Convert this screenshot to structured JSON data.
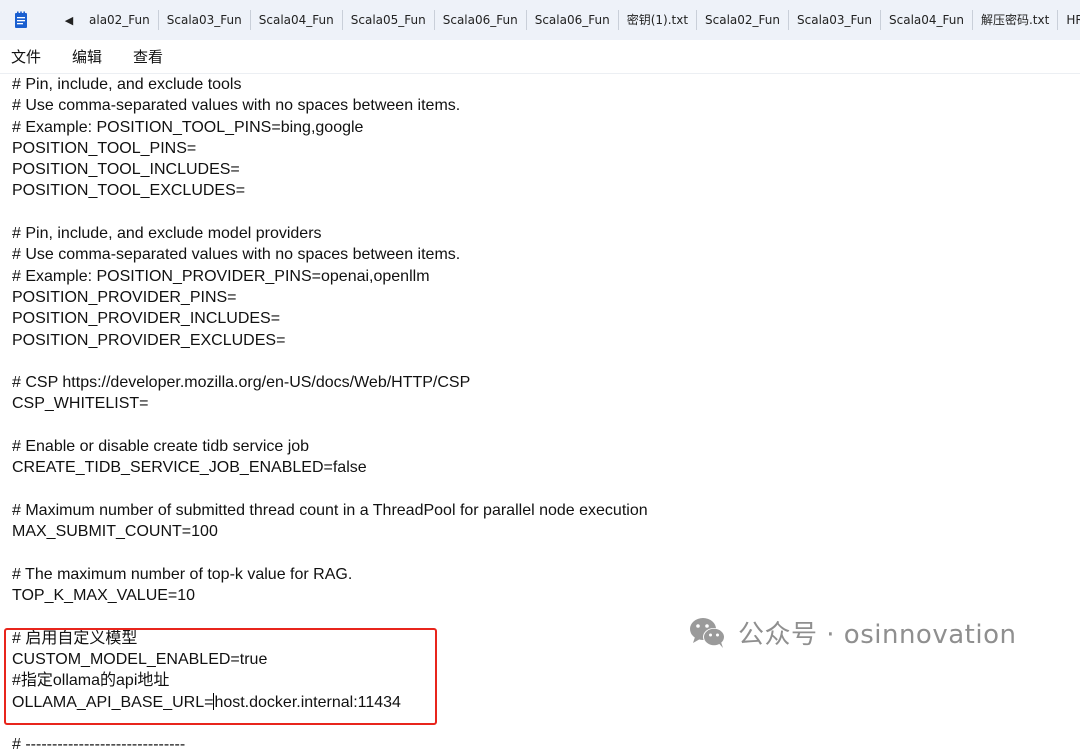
{
  "tabbar": {
    "scroll_left_icon": "◀",
    "tabs": [
      "ala02_Fun",
      "Scala03_Fun",
      "Scala04_Fun",
      "Scala05_Fun",
      "Scala06_Fun",
      "Scala06_Fun",
      "密钥(1).txt",
      "Scala02_Fun",
      "Scala03_Fun",
      "Scala04_Fun",
      "解压密码.txt",
      "HR-人"
    ]
  },
  "menubar": {
    "file": "文件",
    "edit": "编辑",
    "view": "查看"
  },
  "editor": {
    "lines": [
      "# Pin, include, and exclude tools",
      "# Use comma-separated values with no spaces between items.",
      "# Example: POSITION_TOOL_PINS=bing,google",
      "POSITION_TOOL_PINS=",
      "POSITION_TOOL_INCLUDES=",
      "POSITION_TOOL_EXCLUDES=",
      "",
      "# Pin, include, and exclude model providers",
      "# Use comma-separated values with no spaces between items.",
      "# Example: POSITION_PROVIDER_PINS=openai,openllm",
      "POSITION_PROVIDER_PINS=",
      "POSITION_PROVIDER_INCLUDES=",
      "POSITION_PROVIDER_EXCLUDES=",
      "",
      "# CSP https://developer.mozilla.org/en-US/docs/Web/HTTP/CSP",
      "CSP_WHITELIST=",
      "",
      "# Enable or disable create tidb service job",
      "CREATE_TIDB_SERVICE_JOB_ENABLED=false",
      "",
      "# Maximum number of submitted thread count in a ThreadPool for parallel node execution",
      "MAX_SUBMIT_COUNT=100",
      "",
      "# The maximum number of top-k value for RAG.",
      "TOP_K_MAX_VALUE=10",
      "",
      "# 启用自定义模型",
      "CUSTOM_MODEL_ENABLED=true",
      "#指定ollama的api地址"
    ],
    "caret_line_before": "OLLAMA_API_BASE_URL=",
    "caret_line_after": "host.docker.internal:11434",
    "last_line": "# ------------------------------"
  },
  "watermark": {
    "text": "公众号 · osinnovation"
  },
  "colors": {
    "tabbar_bg": "#eef2f9",
    "highlight_border": "#e8251c",
    "watermark": "#8f8f8f",
    "app_icon": "#1a5fd0"
  }
}
